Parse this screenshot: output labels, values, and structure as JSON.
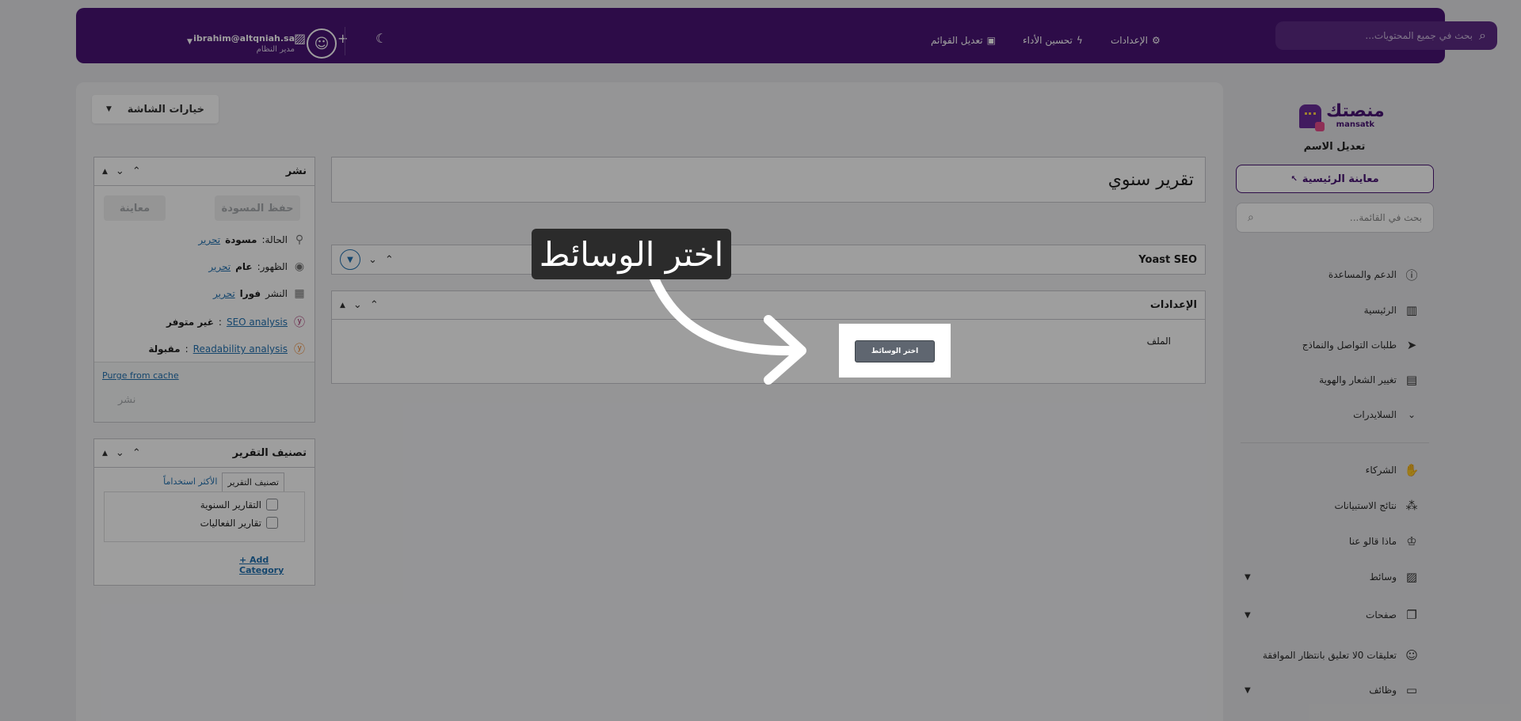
{
  "topbar": {
    "search_placeholder": "بحث في جميع المحتويات...",
    "settings_label": "الإعدادات",
    "performance_label": "تحسين الأداء",
    "menus_label": "تعديل القوائم",
    "user_email": "ibrahim@altqniah.sa",
    "user_role": "مدير النظام"
  },
  "sidebar": {
    "logo_ar": "منصتك",
    "logo_en": "mansatk",
    "site_name": "تعديل الاسم",
    "preview_label": "معاينة الرئيسية",
    "search_placeholder": "بحث في القائمة...",
    "items": [
      {
        "label": "الدعم والمساعدة",
        "icon": "help-circle-icon"
      },
      {
        "label": "الرئيسية",
        "icon": "chart-icon"
      },
      {
        "label": "طلبات التواصل والنماذج",
        "icon": "send-icon"
      },
      {
        "label": "تغيير الشعار والهوية",
        "icon": "layout-icon"
      },
      {
        "label": "السلايدرات",
        "icon": "chevron-down-icon"
      },
      {
        "label": "الشركاء",
        "icon": "handshake-icon"
      },
      {
        "label": "نتائج الاستبيانات",
        "icon": "shapes-icon"
      },
      {
        "label": "ماذا قالو عنا",
        "icon": "crown-icon"
      },
      {
        "label": "وسائط",
        "icon": "image-icon"
      },
      {
        "label": "صفحات",
        "icon": "pages-icon"
      },
      {
        "label": "تعليقات 0لا تعليق بانتظار الموافقة",
        "icon": "comment-icon"
      },
      {
        "label": "وظائف",
        "icon": "briefcase-icon"
      }
    ]
  },
  "main": {
    "screen_options_label": "خيارات الشاشة",
    "post_title": "تقرير سنوي",
    "yoast_title": "Yoast SEO",
    "settings_title": "الإعدادات",
    "file_label": "الملف",
    "select_media_label": "اختر الوسائط"
  },
  "publish": {
    "title": "نشر",
    "save_draft": "حفظ المسودة",
    "preview": "معاينة",
    "status_label": "الحالة:",
    "status_value": "مسودة",
    "visibility_label": "الظهور:",
    "visibility_value": "عام",
    "publish_label": "النشر",
    "publish_value": "فورا",
    "edit_link": "تحرير",
    "seo_link": "SEO analysis",
    "seo_value": "غير متوفر",
    "readability_link": "Readability analysis",
    "readability_value": "مقبولة",
    "purge_label": "Purge from cache",
    "publish_button": "نشر"
  },
  "category": {
    "title": "تصنيف التقرير",
    "tab_all": "تصنيف التقرير",
    "tab_popular": "الأكثر استخداماً",
    "items": [
      "التقارير السنوية",
      "تقارير الفعاليات"
    ],
    "add_label": "+ Add Category"
  },
  "callout": {
    "text": "اختر الوسائط"
  },
  "colors": {
    "brand": "#4a1475",
    "link": "#2271b1",
    "overlay": "rgba(0,0,0,0.38)"
  }
}
